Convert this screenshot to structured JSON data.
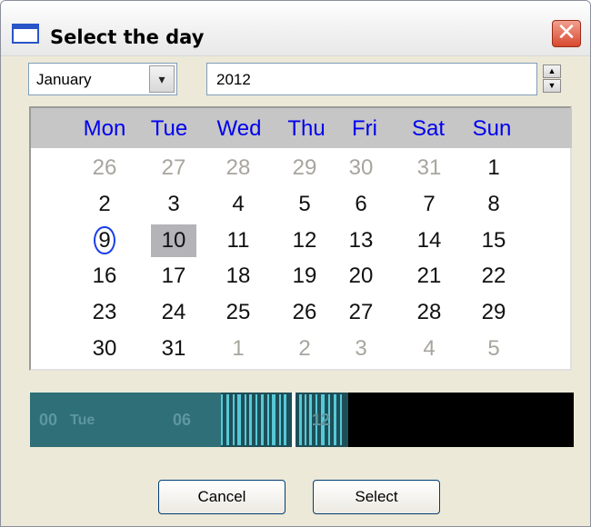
{
  "window": {
    "title": "Select the day",
    "close_label": "✕"
  },
  "month": {
    "value": "January",
    "arrow": "▾"
  },
  "year": {
    "value": "2012",
    "up": "▲",
    "down": "▼"
  },
  "weekdays": [
    "Mon",
    "Tue",
    "Wed",
    "Thu",
    "Fri",
    "Sat",
    "Sun"
  ],
  "weeks": [
    [
      "26",
      "27",
      "28",
      "29",
      "30",
      "31",
      "1"
    ],
    [
      "2",
      "3",
      "4",
      "5",
      "6",
      "7",
      "8"
    ],
    [
      "9",
      "10",
      "11",
      "12",
      "13",
      "14",
      "15"
    ],
    [
      "16",
      "17",
      "18",
      "19",
      "20",
      "21",
      "22"
    ],
    [
      "23",
      "24",
      "25",
      "26",
      "27",
      "28",
      "29"
    ],
    [
      "30",
      "31",
      "1",
      "2",
      "3",
      "4",
      "5"
    ]
  ],
  "timeline": {
    "label_00": "00",
    "label_day": "Tue",
    "label_06": "06",
    "label_12": "12"
  },
  "buttons": {
    "cancel": "Cancel",
    "select": "Select"
  },
  "colors": {
    "weekday_text": "#0000ee",
    "other_month_text": "#a8a59e",
    "today_ring": "#1a3de8",
    "selected_bg": "#b4b4b8",
    "timeline_teal": "#2e6f78"
  }
}
